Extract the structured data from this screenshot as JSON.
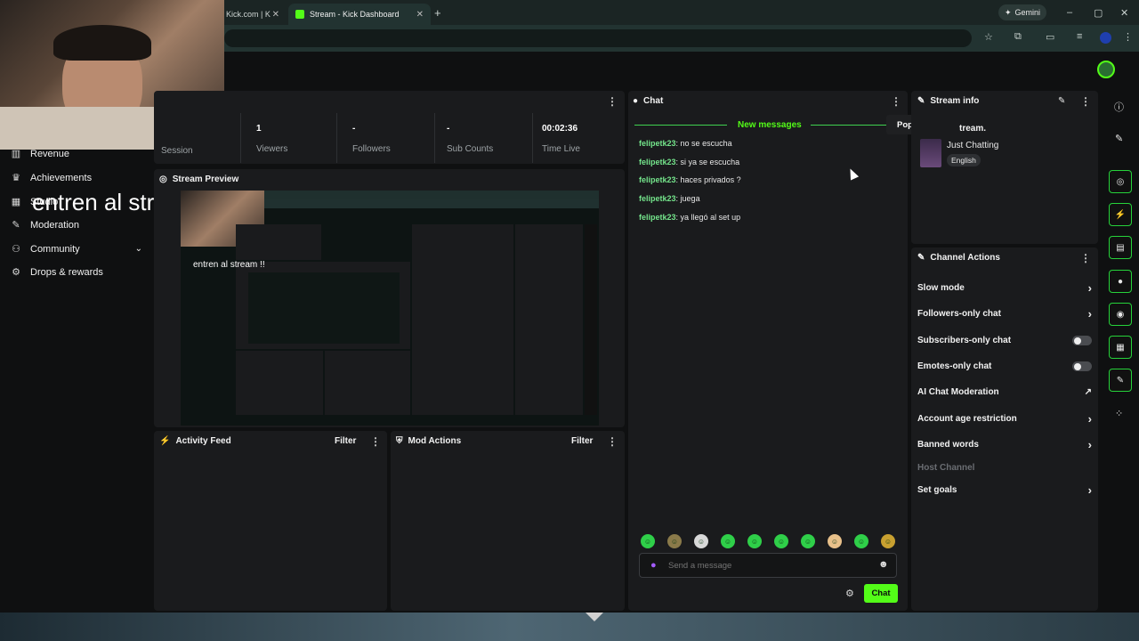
{
  "browser": {
    "tabs": [
      {
        "label": "Kick.com | K"
      },
      {
        "label": "Stream - Kick Dashboard"
      }
    ],
    "new_tab": "+",
    "gemini": "Gemini",
    "window_controls": [
      "–",
      "▢",
      "✕"
    ]
  },
  "sidebar": {
    "items": [
      {
        "label": "Revenue",
        "icon": "chart-icon"
      },
      {
        "label": "Achievements",
        "icon": "trophy-icon"
      },
      {
        "label": "Studio",
        "icon": "studio-icon"
      },
      {
        "label": "Moderation",
        "icon": "wrench-icon"
      },
      {
        "label": "Community",
        "icon": "community-icon"
      },
      {
        "label": "Drops & rewards",
        "icon": "drops-icon"
      }
    ],
    "overlay_text": "entren al stream !!"
  },
  "stats": {
    "session_label": "Session",
    "items": [
      {
        "value": "1",
        "label": "Viewers"
      },
      {
        "value": "-",
        "label": "Followers"
      },
      {
        "value": "-",
        "label": "Sub Counts"
      },
      {
        "value": "00:02:36",
        "label": "Time Live"
      }
    ]
  },
  "preview": {
    "title": "Stream Preview",
    "overlay_text": "entren al stream !!"
  },
  "activity": {
    "title": "Activity Feed",
    "filter": "Filter"
  },
  "mod": {
    "title": "Mod Actions",
    "filter": "Filter"
  },
  "chat": {
    "title": "Chat",
    "new_messages": "New messages",
    "popout": "Popout Chat",
    "messages": [
      {
        "user": "felipetk23",
        "text": "no se escucha"
      },
      {
        "user": "felipetk23",
        "text": "si ya se escucha"
      },
      {
        "user": "felipetk23",
        "text": "haces privados ?"
      },
      {
        "user": "felipetk23",
        "text": "juega"
      },
      {
        "user": "felipetk23",
        "text": "ya llegó al set up"
      }
    ],
    "placeholder": "Send a message",
    "send": "Chat"
  },
  "stream_info": {
    "title": "Stream info",
    "stream_title": "tream.",
    "category": "Just Chatting",
    "language": "English"
  },
  "channel_actions": {
    "title": "Channel Actions",
    "items": [
      {
        "label": "Slow mode",
        "control": "chevron"
      },
      {
        "label": "Followers-only chat",
        "control": "chevron"
      },
      {
        "label": "Subscribers-only chat",
        "control": "toggle"
      },
      {
        "label": "Emotes-only chat",
        "control": "toggle"
      },
      {
        "label": "AI Chat Moderation",
        "control": "external"
      },
      {
        "label": "Account age restriction",
        "control": "chevron"
      },
      {
        "label": "Banned words",
        "control": "chevron"
      },
      {
        "label": "Host Channel",
        "control": "disabled"
      },
      {
        "label": "Set goals",
        "control": "chevron"
      }
    ]
  },
  "colors": {
    "accent": "#53fc18",
    "username": "#74e48b",
    "panel": "#1a1b1d",
    "background": "#0f1011"
  }
}
